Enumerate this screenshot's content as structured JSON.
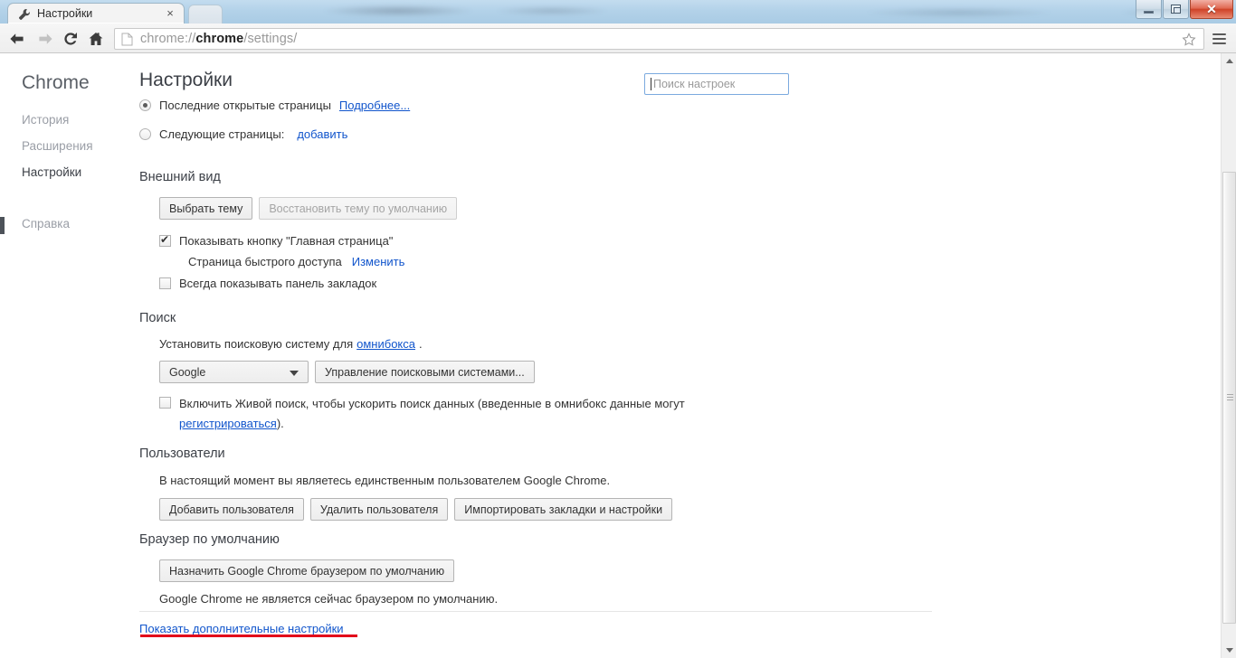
{
  "window": {
    "minimize_label": "Свернуть",
    "restore_label": "Развернуть",
    "close_label": "Закрыть"
  },
  "tab": {
    "title": "Настройки",
    "icon": "wrench-icon",
    "close_label": "×"
  },
  "toolbar": {
    "back_label": "Назад",
    "forward_label": "Вперёд",
    "reload_label": "Обновить",
    "home_label": "Главная страница",
    "url_prefix": "chrome://",
    "url_domain": "chrome",
    "url_suffix": "/settings/",
    "star_label": "Добавить в закладки",
    "menu_label": "Меню"
  },
  "sidebar": {
    "brand": "Chrome",
    "items": [
      {
        "label": "История",
        "active": false
      },
      {
        "label": "Расширения",
        "active": false
      },
      {
        "label": "Настройки",
        "active": true
      },
      {
        "label": "Справка",
        "active": false
      }
    ]
  },
  "main": {
    "title": "Настройки",
    "search": {
      "placeholder": "Поиск настроек",
      "value": ""
    },
    "startup": {
      "option_recent": "Последние открытые страницы",
      "option_recent_link": "Подробнее...",
      "option_pages": "Следующие страницы:",
      "option_pages_link": "добавить"
    },
    "appearance": {
      "title": "Внешний вид",
      "choose_theme": "Выбрать тему",
      "reset_theme": "Восстановить тему по умолчанию",
      "show_home_button": "Показывать кнопку \"Главная страница\"",
      "home_page_value": "Страница быстрого доступа",
      "home_page_change": "Изменить",
      "always_show_bookmarks": "Всегда показывать панель закладок"
    },
    "search_section": {
      "title": "Поиск",
      "description_before": "Установить поисковую систему для",
      "description_link": "омнибокса",
      "description_after": ".",
      "engine_value": "Google",
      "manage_engines": "Управление поисковыми системами...",
      "instant_line1": "Включить Живой поиск, чтобы ускорить поиск данных (введенные в омнибокс данные могут",
      "instant_link": "регистрироваться",
      "instant_after": ")."
    },
    "users": {
      "title": "Пользователи",
      "description": "В настоящий момент вы являетесь единственным пользователем Google Chrome.",
      "add_user": "Добавить пользователя",
      "delete_user": "Удалить пользователя",
      "import": "Импортировать закладки и настройки"
    },
    "default_browser": {
      "title": "Браузер по умолчанию",
      "make_default": "Назначить Google Chrome браузером по умолчанию",
      "status": "Google Chrome не является сейчас браузером по умолчанию."
    },
    "show_advanced": "Показать дополнительные настройки"
  },
  "colors": {
    "link": "#1155cc",
    "accent": "#4d5259",
    "annotation": "#e2001a",
    "focus_border": "#7baadf"
  }
}
